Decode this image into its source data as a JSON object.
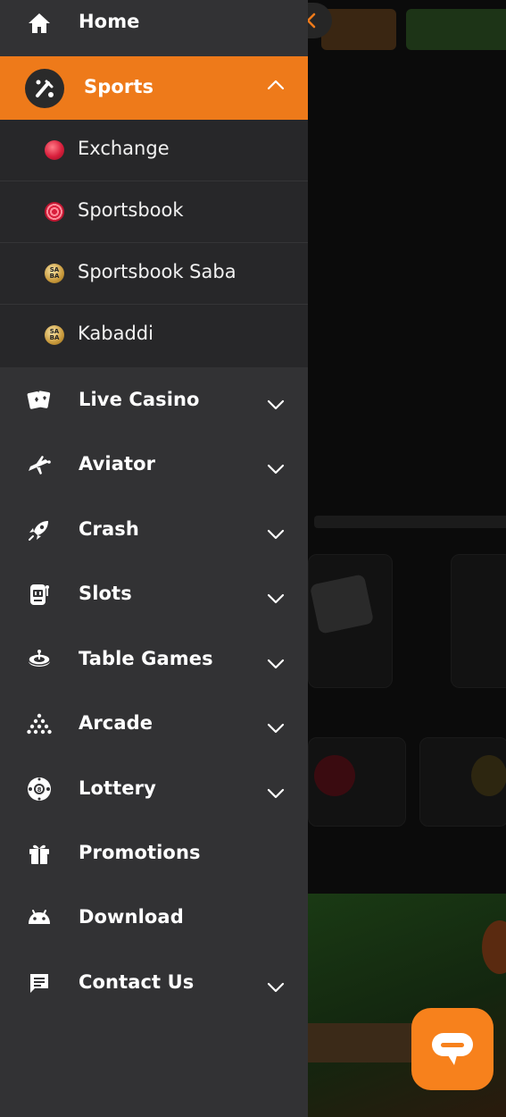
{
  "menu": {
    "home": {
      "label": "Home",
      "icon": "home-icon"
    },
    "sports": {
      "label": "Sports",
      "icon": "sports-icon",
      "expanded": true,
      "accent": "#ee7a1a",
      "children": [
        {
          "label": "Exchange",
          "icon": "cricket-ball-icon"
        },
        {
          "label": "Sportsbook",
          "icon": "sportsbook-icon"
        },
        {
          "label": "Sportsbook Saba",
          "icon": "saba-icon"
        },
        {
          "label": "Kabaddi",
          "icon": "saba-icon"
        }
      ]
    },
    "items": [
      {
        "label": "Live Casino",
        "icon": "cards-icon"
      },
      {
        "label": "Aviator",
        "icon": "plane-icon"
      },
      {
        "label": "Crash",
        "icon": "rocket-icon"
      },
      {
        "label": "Slots",
        "icon": "slot-machine-icon"
      },
      {
        "label": "Table Games",
        "icon": "roulette-icon"
      },
      {
        "label": "Arcade",
        "icon": "arcade-icon"
      },
      {
        "label": "Lottery",
        "icon": "lottery-ball-icon"
      },
      {
        "label": "Promotions",
        "icon": "gift-icon"
      },
      {
        "label": "Download",
        "icon": "android-icon"
      },
      {
        "label": "Contact Us",
        "icon": "chat-icon"
      }
    ]
  },
  "saba_badge_text": "SA BA",
  "colors": {
    "drawer_bg": "#323234",
    "submenu_bg": "#272729",
    "accent": "#ee7a1a",
    "chat_button": "#f7811c"
  }
}
